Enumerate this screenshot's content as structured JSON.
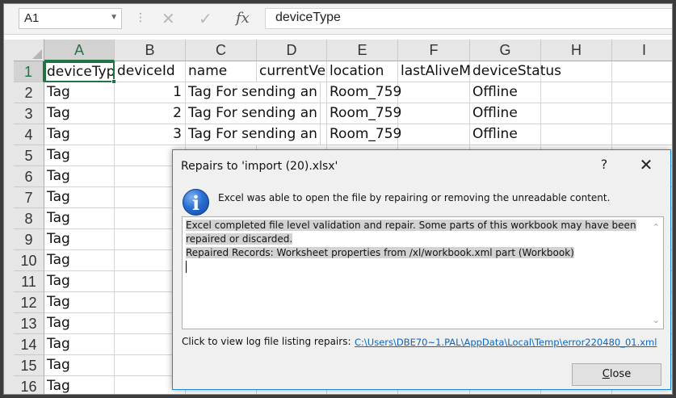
{
  "formula_bar": {
    "name_box": "A1",
    "cancel_icon": "cross-icon",
    "enter_icon": "check-icon",
    "function_label": "fx",
    "content": "deviceType"
  },
  "columns": [
    "A",
    "B",
    "C",
    "D",
    "E",
    "F",
    "G",
    "H",
    "I"
  ],
  "rows": [
    "1",
    "2",
    "3",
    "4",
    "5",
    "6",
    "7",
    "8",
    "9",
    "10",
    "11",
    "12",
    "13",
    "14",
    "15",
    "16"
  ],
  "header_row": [
    "deviceTyp",
    "deviceId",
    "name",
    "currentVe",
    "location",
    "lastAliveM",
    "deviceStatus"
  ],
  "data_rows": [
    {
      "type": "Tag",
      "id": "1",
      "name": "Tag For sending an a",
      "location": "Room_759",
      "status": "Offline"
    },
    {
      "type": "Tag",
      "id": "2",
      "name": "Tag For sending an a",
      "location": "Room_759",
      "status": "Offline"
    },
    {
      "type": "Tag",
      "id": "3",
      "name": "Tag For sending an a",
      "location": "Room_759",
      "status": "Offline"
    }
  ],
  "col_a_more": [
    "Tag",
    "Tag",
    "Tag",
    "Tag",
    "Tag",
    "Tag",
    "Tag",
    "Tag",
    "Tag",
    "Tag",
    "Tag",
    "Tag"
  ],
  "col_b_partial": [
    "1",
    "1",
    "1",
    "1",
    "1",
    "1"
  ],
  "dialog": {
    "title": "Repairs to 'import (20).xlsx'",
    "help": "?",
    "close_glyph": "✕",
    "icon": "info-icon",
    "message": "Excel was able to open the file by repairing or removing the unreadable content.",
    "details_line1": "Excel completed file level validation and repair. Some parts of this workbook may have been",
    "details_line2": "repaired or discarded.",
    "details_line3": "Repaired Records: Worksheet properties from /xl/workbook.xml part (Workbook)",
    "log_label": "Click to view log file listing repairs:",
    "log_link": "C:\\Users\\DBE70~1.PAL\\AppData\\Local\\Temp\\error220480_01.xml",
    "close_button_accel": "C",
    "close_button_rest": "lose"
  }
}
